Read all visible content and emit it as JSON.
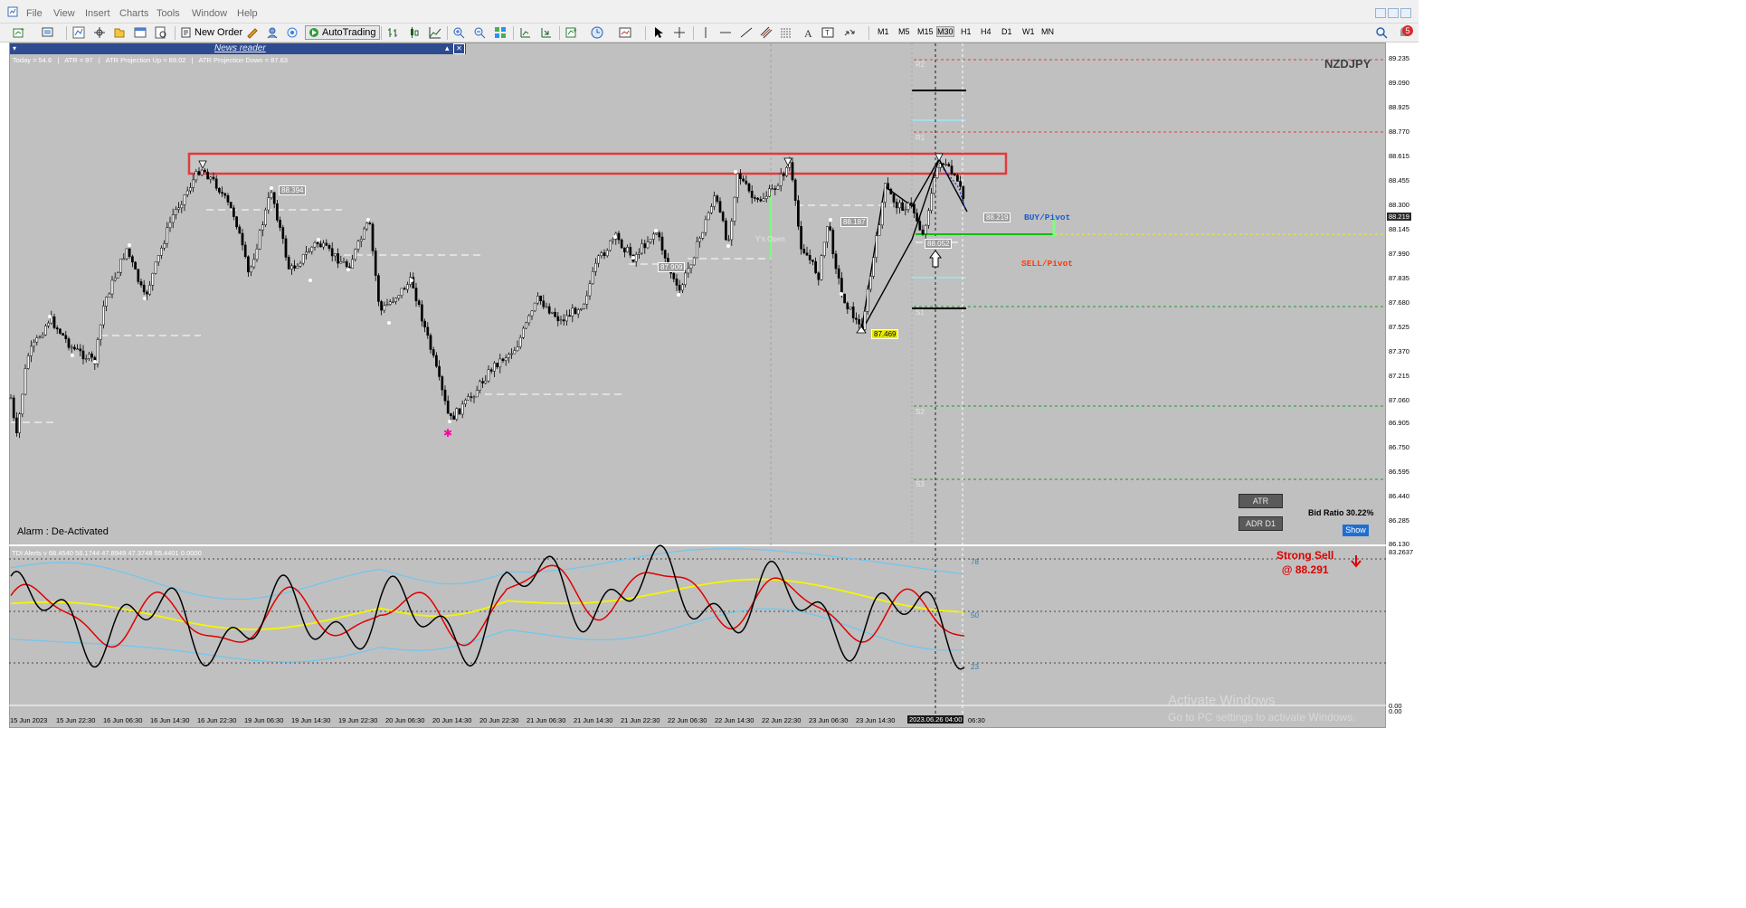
{
  "menu": {
    "items": [
      "File",
      "View",
      "Insert",
      "Charts",
      "Tools",
      "Window",
      "Help"
    ]
  },
  "toolbar": {
    "new_order": "New Order",
    "autotrading": "AutoTrading",
    "timeframes": [
      "M1",
      "M5",
      "M15",
      "M30",
      "H1",
      "H4",
      "D1",
      "W1",
      "MN"
    ],
    "active_timeframe": "M30",
    "notification_count": "5"
  },
  "chart": {
    "symbol": "NZDJPY",
    "news_reader_title": "News reader",
    "info_line": "Today = 54.6   |   ATR = 97   |   ATR Projection Up = 89.02   |   ATR Projection Down = 87.63",
    "alarm_status": "Alarm : De-Activated",
    "buy_pivot": "BUY/Pivot",
    "sell_pivot": "SELL/Pivot",
    "ys_open": "Y's Open",
    "pivot_levels": [
      "R2",
      "R1",
      "S1",
      "S2",
      "S3"
    ],
    "price_boxes": [
      "88.394",
      "87.909",
      "88.187",
      "87.469",
      "88.219",
      "88.052"
    ],
    "price_axis": [
      "89.235",
      "89.090",
      "88.925",
      "88.770",
      "88.615",
      "88.455",
      "88.300",
      "88.145",
      "87.990",
      "87.835",
      "87.680",
      "87.525",
      "87.370",
      "87.215",
      "87.060",
      "86.905",
      "86.750",
      "86.595",
      "86.440",
      "86.285",
      "86.130"
    ],
    "current_price": "88.219",
    "date_axis": [
      "15 Jun 2023",
      "15 Jun 22:30",
      "16 Jun 06:30",
      "16 Jun 14:30",
      "16 Jun 22:30",
      "19 Jun 06:30",
      "19 Jun 14:30",
      "19 Jun 22:30",
      "20 Jun 06:30",
      "20 Jun 14:30",
      "20 Jun 22:30",
      "21 Jun 06:30",
      "21 Jun 14:30",
      "21 Jun 22:30",
      "22 Jun 06:30",
      "22 Jun 14:30",
      "22 Jun 22:30",
      "23 Jun 06:30",
      "23 Jun 14:30"
    ],
    "current_date": "2023.06.26 04:00",
    "date_after": "06:30",
    "atr_button": "ATR",
    "adr_button": "ADR D1",
    "bid_ratio": "Bid Ratio 30.22%",
    "show_button": "Show"
  },
  "indicator": {
    "label": "TDI Alerts v 68.4540 58.1744 47.8949 47.3748 55.4401 0.0000",
    "level_top": "78",
    "level_mid": "50",
    "level_low": "23",
    "axis_top": "83.2637",
    "axis_bottom": "0.00",
    "axis_mid": "0.00",
    "signal": "Strong Sell",
    "signal_price": "@ 88.291"
  },
  "watermark": {
    "title": "Activate Windows",
    "subtitle": "Go to PC settings to activate Windows."
  },
  "colors": {
    "chart_bg": "#c0c0c0",
    "rsi_line": "#000000",
    "signal_line": "#e00000",
    "mid_band": "#f5f500",
    "bands": "#6ec6f0",
    "highlight_box": "#e03030",
    "pivot_green": "#00c000"
  }
}
